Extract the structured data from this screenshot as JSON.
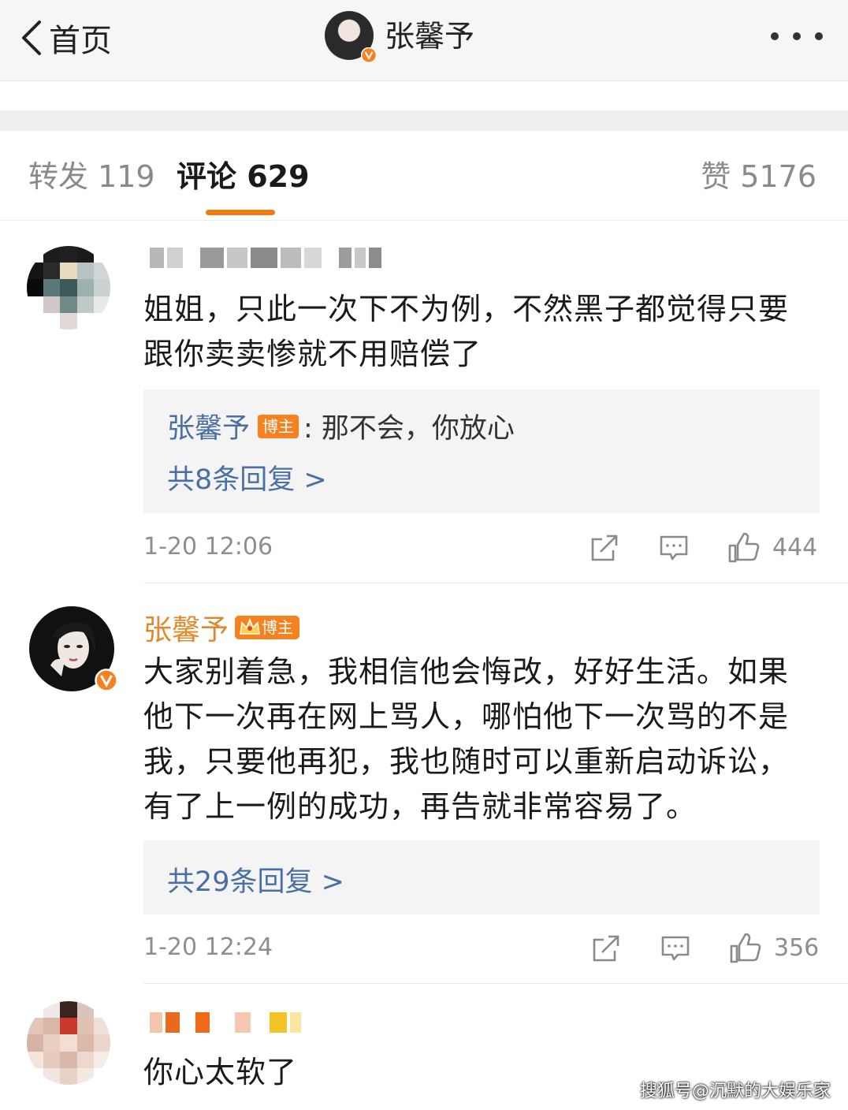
{
  "nav": {
    "back_label": "首页",
    "title": "张馨予"
  },
  "tabs": {
    "repost": "转发 119",
    "comment": "评论 629",
    "like": "赞 5176"
  },
  "comments": [
    {
      "text": "姐姐，只此一次下不为例，不然黑子都觉得只要跟你卖卖惨就不用赔偿了",
      "reply_preview": {
        "name": "张馨予",
        "badge": "博主",
        "text": ": 那不会，你放心"
      },
      "reply_count": "共8条回复 >",
      "time": "1-20 12:06",
      "likes": "444"
    },
    {
      "author": "张馨予",
      "badge": "博主",
      "text": "大家别着急，我相信他会悔改，好好生活。如果他下一次再在网上骂人，哪怕他下一次骂的不是我，只要他再犯，我也随时可以重新启动诉讼，有了上一例的成功，再告就非常容易了。",
      "reply_count": "共29条回复 >",
      "time": "1-20 12:24",
      "likes": "356"
    },
    {
      "text": "你心太软了"
    }
  ],
  "watermark": "搜狐号@沉默的大娱乐家",
  "icons": [
    "back-chevron-icon",
    "verified-v-icon",
    "more-dots-icon",
    "share-icon",
    "comment-icon",
    "like-thumb-icon",
    "crown-icon"
  ],
  "colors": {
    "accent": "#f07b12",
    "link_blue": "#4a6fa5",
    "author_orange": "#e0892b"
  }
}
